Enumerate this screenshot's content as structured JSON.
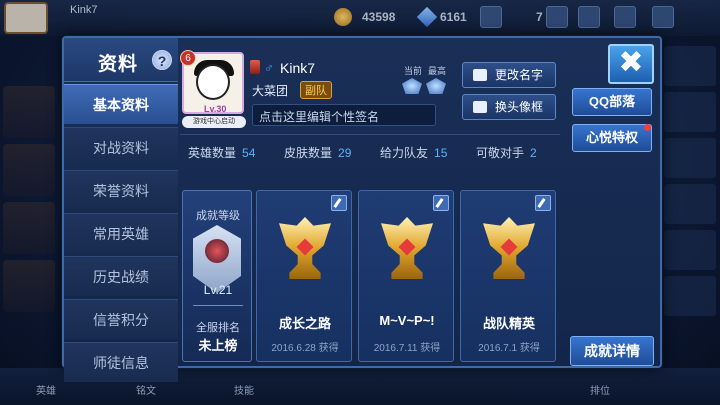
{
  "background": {
    "top_name": "Kink7",
    "currency_gold": "43598",
    "currency_gem": "6161",
    "top_right_count": "7",
    "bottom_nav": [
      "英雄",
      "铭文",
      "技能",
      "",
      "",
      "",
      "",
      "排位"
    ]
  },
  "panel": {
    "title": "资料",
    "help_label": "?",
    "close_label": "✖",
    "tabs": [
      "基本资料",
      "对战资料",
      "荣誉资料",
      "常用英雄",
      "历史战绩",
      "信誉积分",
      "师徒信息"
    ],
    "active_tab": 0
  },
  "profile": {
    "level": "6",
    "avatar_level_text": "Lv.30",
    "status_text": "游戏中心启动",
    "gender_symbol": "♂",
    "name": "Kink7",
    "guild": "大菜团",
    "guild_role": "副队",
    "signature_placeholder": "点击这里编辑个性签名",
    "season_current_label": "当前",
    "season_best_label": "最高",
    "rename_label": "更改名字",
    "change_frame_label": "换头像框"
  },
  "stats": [
    {
      "label": "英雄数量",
      "value": "54"
    },
    {
      "label": "皮肤数量",
      "value": "29"
    },
    {
      "label": "给力队友",
      "value": "15"
    },
    {
      "label": "可敬对手",
      "value": "2"
    }
  ],
  "rank": {
    "title": "成就等级",
    "level": "Lv.21",
    "server_rank_label": "全服排名",
    "server_rank_value": "未上榜"
  },
  "achievements": [
    {
      "name": "成长之路",
      "date": "2016.6.28 获得"
    },
    {
      "name": "M~V~P~!",
      "date": "2016.7.11 获得"
    },
    {
      "name": "战队精英",
      "date": "2016.7.1 获得"
    }
  ],
  "right_buttons": {
    "qq": "QQ部落",
    "vip": "心悦特权",
    "detail": "成就详情"
  }
}
